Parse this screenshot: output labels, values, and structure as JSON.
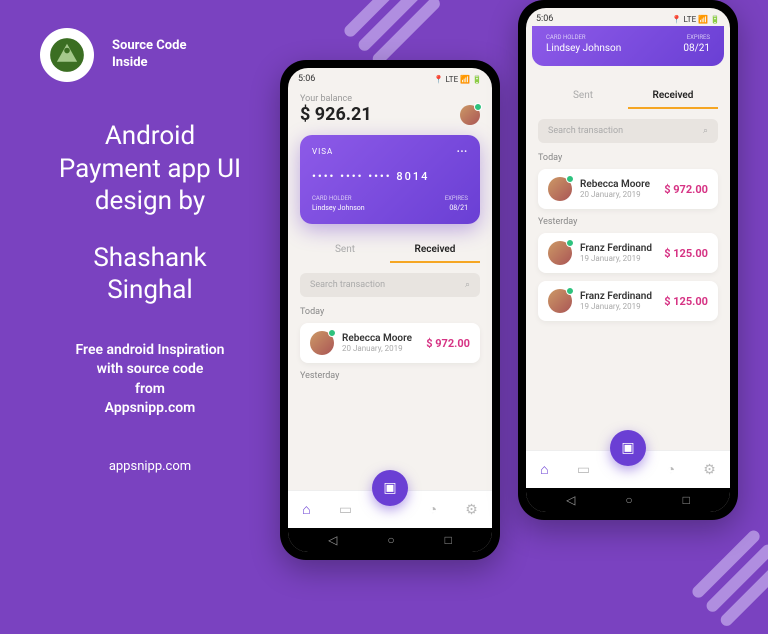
{
  "logo": {
    "line1": "Source Code",
    "line2": "Inside"
  },
  "heading": {
    "line1": "Android",
    "line2": "Payment app UI",
    "line3": "design by",
    "author1": "Shashank",
    "author2": "Singhal"
  },
  "subtitle": {
    "line1": "Free android Inspiration",
    "line2": "with source code",
    "line3": "from",
    "line4": "Appsnipp.com"
  },
  "domain": "appsnipp.com",
  "status": {
    "time": "5:06",
    "indicators": "📍 LTE 📶 🔋"
  },
  "balance": {
    "label": "Your balance",
    "amount": "$ 926.21"
  },
  "card": {
    "brand": "VISA",
    "dots": "•••",
    "number": "•••• •••• •••• 8014",
    "holder_label": "CARD HOLDER",
    "holder": "Lindsey Johnson",
    "expires_label": "EXPIRES",
    "expires": "08/21"
  },
  "tabs": {
    "sent": "Sent",
    "received": "Received"
  },
  "search": {
    "placeholder": "Search transaction"
  },
  "sections": {
    "today": "Today",
    "yesterday": "Yesterday"
  },
  "transactions": {
    "today": [
      {
        "name": "Rebecca Moore",
        "date": "20 January, 2019",
        "amount": "$ 972.00"
      }
    ],
    "yesterday": [
      {
        "name": "Franz Ferdinand",
        "date": "19 January, 2019",
        "amount": "$ 125.00"
      },
      {
        "name": "Franz Ferdinand",
        "date": "19 January, 2019",
        "amount": "$ 125.00"
      }
    ]
  }
}
